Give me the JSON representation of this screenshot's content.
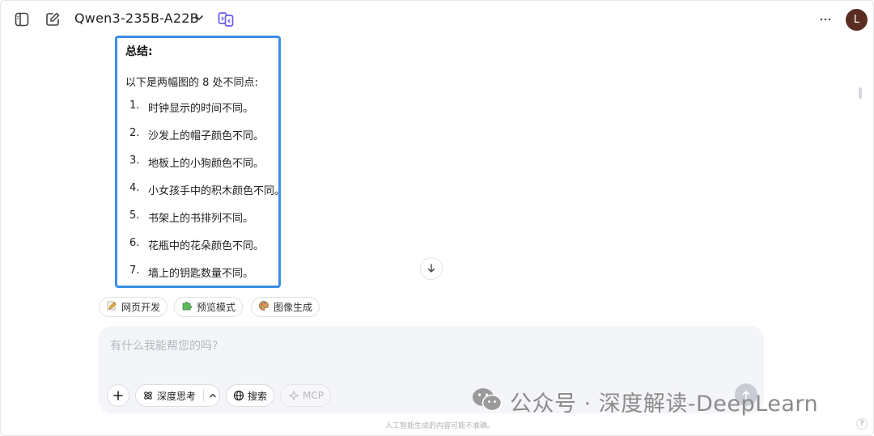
{
  "header": {
    "model_name": "Qwen3-235B-A22B",
    "avatar_letter": "L"
  },
  "summary": {
    "title": "总结:",
    "intro": "以下是两幅图的 8 处不同点:",
    "items": [
      {
        "num": "1.",
        "text": "时钟显示的时间不同。"
      },
      {
        "num": "2.",
        "text": "沙发上的帽子颜色不同。"
      },
      {
        "num": "3.",
        "text": "地板上的小狗颜色不同。"
      },
      {
        "num": "4.",
        "text": "小女孩手中的积木颜色不同。"
      },
      {
        "num": "5.",
        "text": "书架上的书排列不同。"
      },
      {
        "num": "6.",
        "text": "花瓶中的花朵颜色不同。"
      },
      {
        "num": "7.",
        "text": "墙上的钥匙数量不同。"
      }
    ]
  },
  "chips": [
    {
      "label": "网页开发",
      "icon": "pencil-emoji-icon"
    },
    {
      "label": "预览模式",
      "icon": "puzzle-emoji-icon"
    },
    {
      "label": "图像生成",
      "icon": "palette-emoji-icon"
    }
  ],
  "composer": {
    "placeholder": "有什么我能帮您的吗?",
    "deep_think_label": "深度思考",
    "search_label": "搜索",
    "mcp_label": "MCP"
  },
  "footer": {
    "note": "人工智能生成的内容可能不准确。",
    "help": "?"
  },
  "watermark": {
    "text": "公众号 · 深度解读-DeepLearn"
  },
  "colors": {
    "highlight_border": "#3b8ee8",
    "avatar_bg": "#5a2d22",
    "composer_bg": "#f4f5f9",
    "accent_icon": "#6b5cf0"
  }
}
